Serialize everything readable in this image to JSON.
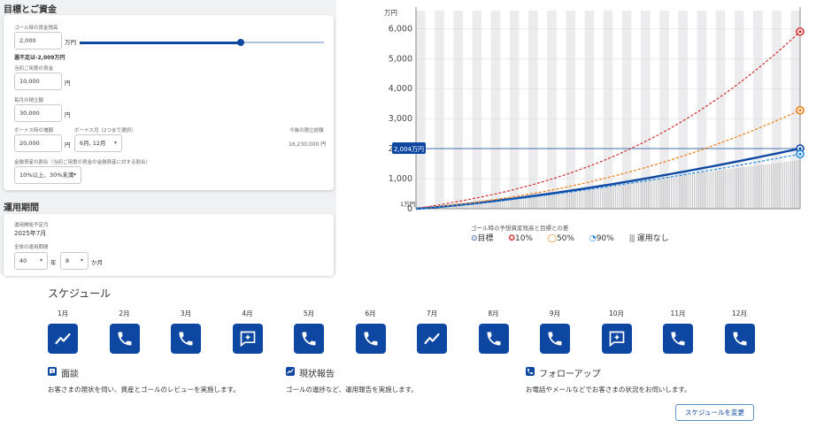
{
  "goal_section": {
    "title": "目標とご資金",
    "goal_label": "ゴール時の資金残高",
    "goal_value": "2,000",
    "goal_unit": "万円",
    "shortage_note": "過不足は-2,009万円",
    "initial_label": "当初ご用意の資金",
    "initial_value": "10,000",
    "initial_unit": "円",
    "monthly_label": "毎月の積立額",
    "monthly_value": "30,000",
    "monthly_unit": "円",
    "bonus_label": "ボーナス時の増額",
    "bonus_value": "20,000",
    "bonus_unit": "円",
    "bonus_month_label": "ボーナス月（2つまで選択）",
    "bonus_month_value": "6月, 12月",
    "future_total_label": "今後の積立総額",
    "future_total_value": "16,230,000 円",
    "ratio_label": "金融資産の割合（当初ご用意の資金の金融資産に対する割合）",
    "ratio_value": "10%以上、30%未満",
    "slider_ratio": 0.66
  },
  "period_section": {
    "title": "運用期間",
    "start_label": "運用開始予定月",
    "start_value": "2025年7月",
    "total_label": "全体の運用期間",
    "years_value": "40",
    "years_unit": "年",
    "months_value": "8",
    "months_unit": "か月"
  },
  "chart_data": {
    "type": "line",
    "ylabel": "万円",
    "ylim": [
      0,
      6600
    ],
    "yticks": [
      0,
      1000,
      2000,
      3000,
      4000,
      5000,
      6000
    ],
    "ytick_labels": [
      "0",
      "1,000",
      "2,000",
      "3,000",
      "4,000",
      "5,000",
      "6,000"
    ],
    "x_years": 40.67,
    "target_value": 2004,
    "target_label": "2,004万円",
    "start_label": "1万円",
    "legend_title": "ゴール時の予想資産残高と目標との差",
    "series": [
      {
        "name": "目標",
        "final": 2004,
        "color": "#0d47a1"
      },
      {
        "name": "10%",
        "final": 5900,
        "color": "#d32f2f"
      },
      {
        "name": "50%",
        "final": 3280,
        "color": "#ef7d10"
      },
      {
        "name": "90%",
        "final": 1820,
        "color": "#1e88e5"
      }
    ],
    "baseline_name": "運用なし",
    "baseline_final": 1623
  },
  "schedule": {
    "title": "スケジュール",
    "months": [
      {
        "label": "1月",
        "type": "report"
      },
      {
        "label": "2月",
        "type": "phone"
      },
      {
        "label": "3月",
        "type": "phone"
      },
      {
        "label": "4月",
        "type": "meeting"
      },
      {
        "label": "5月",
        "type": "phone"
      },
      {
        "label": "6月",
        "type": "phone"
      },
      {
        "label": "7月",
        "type": "report"
      },
      {
        "label": "8月",
        "type": "phone"
      },
      {
        "label": "9月",
        "type": "phone"
      },
      {
        "label": "10月",
        "type": "meeting"
      },
      {
        "label": "11月",
        "type": "phone"
      },
      {
        "label": "12月",
        "type": "phone"
      }
    ],
    "categories": [
      {
        "name": "面談",
        "desc": "お客さまの現状を伺い、資産とゴールのレビューを実施します。"
      },
      {
        "name": "現状報告",
        "desc": "ゴールの進捗など、運用報告を実施します。"
      },
      {
        "name": "フォローアップ",
        "desc": "お電話やメールなどでお客さまの状況をお伺いします。"
      }
    ],
    "change_button": "スケジュールを変更"
  },
  "colors": {
    "accent": "#0d47a1",
    "red": "#d32f2f",
    "orange": "#ef7d10",
    "light_blue": "#1e88e5"
  }
}
